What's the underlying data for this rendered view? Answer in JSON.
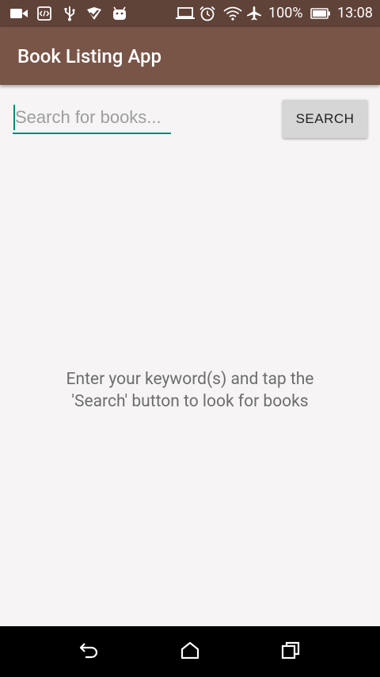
{
  "status_bar": {
    "battery_text": "100%",
    "time": "13:08",
    "left_icons": [
      "video-camera-icon",
      "code-icon",
      "usb-icon",
      "checkbox-icon",
      "android-icon"
    ],
    "right_icons": [
      "laptop-icon",
      "alarm-icon",
      "wifi-icon",
      "airplane-icon",
      "battery-icon"
    ]
  },
  "app_bar": {
    "title": "Book Listing App",
    "color": "#795548"
  },
  "search": {
    "placeholder": "Search for books...",
    "value": "",
    "accent": "#00897b",
    "button_label": "SEARCH"
  },
  "empty_state": {
    "line1": "Enter your keyword(s) and tap the",
    "line2": "'Search' button to look for books"
  },
  "nav_bar": {
    "buttons": [
      "back-icon",
      "home-icon",
      "recents-icon"
    ]
  }
}
